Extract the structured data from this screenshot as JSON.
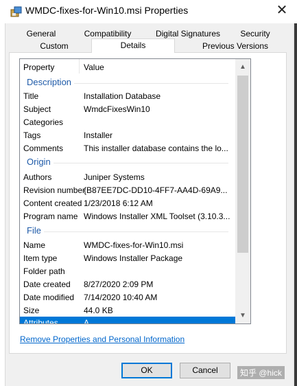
{
  "window": {
    "title": "WMDC-fixes-for-Win10.msi Properties",
    "close_glyph": "✕"
  },
  "tabs": {
    "row1": [
      "General",
      "Compatibility",
      "Digital Signatures",
      "Security"
    ],
    "row2": [
      "Custom",
      "Details",
      "Previous Versions"
    ],
    "active": "Details"
  },
  "list": {
    "header": {
      "property": "Property",
      "value": "Value"
    },
    "groups": {
      "description": "Description",
      "origin": "Origin",
      "file": "File"
    },
    "description_rows": [
      {
        "property": "Title",
        "value": "Installation Database"
      },
      {
        "property": "Subject",
        "value": "WmdcFixesWin10"
      },
      {
        "property": "Categories",
        "value": ""
      },
      {
        "property": "Tags",
        "value": "Installer"
      },
      {
        "property": "Comments",
        "value": "This installer database contains the lo..."
      }
    ],
    "origin_rows": [
      {
        "property": "Authors",
        "value": "Juniper Systems"
      },
      {
        "property": "Revision number",
        "value": "{B87EE7DC-DD10-4FF7-AA4D-69A9..."
      },
      {
        "property": "Content created",
        "value": "1/23/2018 6:12 AM"
      },
      {
        "property": "Program name",
        "value": "Windows Installer XML Toolset (3.10.3..."
      }
    ],
    "file_rows": [
      {
        "property": "Name",
        "value": "WMDC-fixes-for-Win10.msi"
      },
      {
        "property": "Item type",
        "value": "Windows Installer Package"
      },
      {
        "property": "Folder path",
        "value": ""
      },
      {
        "property": "Date created",
        "value": "8/27/2020 2:09 PM"
      },
      {
        "property": "Date modified",
        "value": "7/14/2020 10:40 AM"
      },
      {
        "property": "Size",
        "value": "44.0 KB"
      },
      {
        "property": "Attributes",
        "value": "A"
      }
    ],
    "scroll_up": "▲",
    "scroll_down": "▼"
  },
  "link": "Remove Properties and Personal Information",
  "buttons": {
    "ok": "OK",
    "cancel": "Cancel"
  },
  "watermark": "知乎 @hick",
  "colors": {
    "selection": "#0078d7",
    "group_label": "#1e5aa8",
    "link": "#0066cc"
  }
}
